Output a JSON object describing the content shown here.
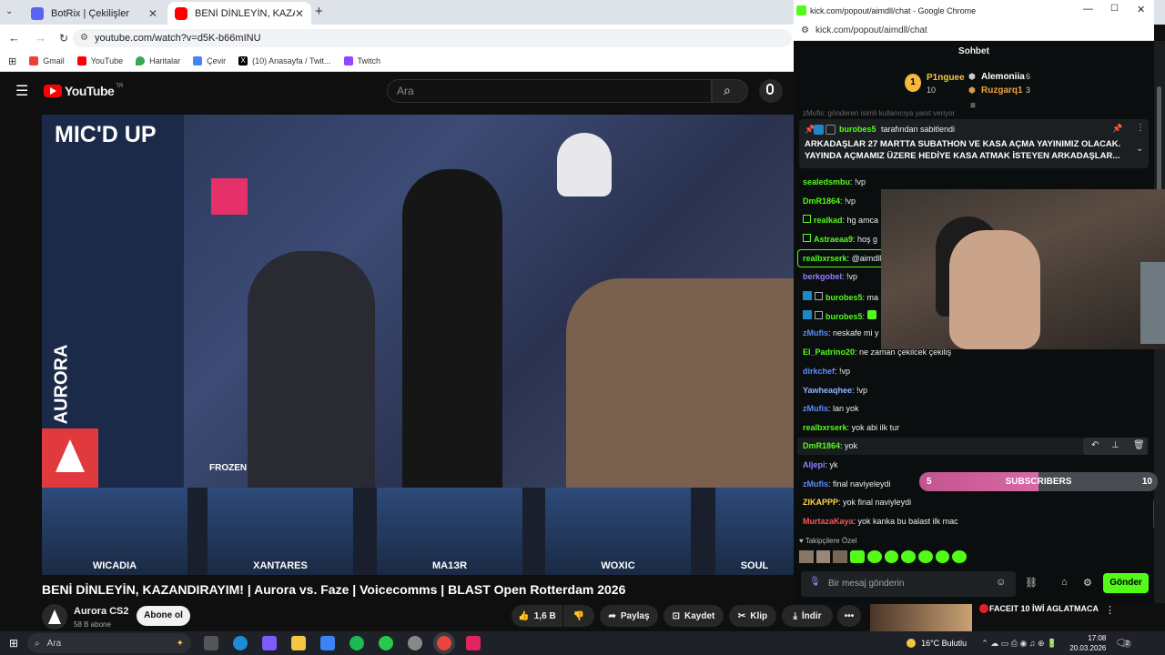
{
  "browser": {
    "tabs": [
      {
        "label": "BotRix | Çekilişler",
        "color": "#5865f2"
      },
      {
        "label": "BENİ DİNLEYİN, KAZANDIRAYIM! ...",
        "color": "#ff0000"
      }
    ],
    "new_tab": "+",
    "url": "youtube.com/watch?v=d5K-b66mINU",
    "bookmarks": [
      {
        "label": "Gmail",
        "color": "#ea4335"
      },
      {
        "label": "YouTube",
        "color": "#ff0000"
      },
      {
        "label": "Haritalar",
        "color": "#34a853"
      },
      {
        "label": "Çevir",
        "color": "#4285f4"
      },
      {
        "label": "(10) Anasayfa / Twit...",
        "color": "#000000"
      },
      {
        "label": "Twitch",
        "color": "#9146ff"
      }
    ]
  },
  "youtube": {
    "logo": "YouTube",
    "region": "TR",
    "search_placeholder": "Ara",
    "video_title": "BENİ DİNLEYİN, KAZANDIRAYIM! | Aurora vs. Faze | Voicecomms | BLAST Open Rotterdam 2026",
    "overlay_title": "MIC'D UP",
    "overlay_team": "AURORA",
    "overlay_frozen": "FROZEN",
    "players": [
      "WICADIA",
      "XANTARES",
      "MA1ЗR",
      "WOXIC",
      "SOUL"
    ],
    "channel_name": "Aurora CS2",
    "subscribers": "58 B abone",
    "subscribe": "Abone ol",
    "likes": "1,6 B",
    "share": "Paylaş",
    "save": "Kaydet",
    "clip": "Klip",
    "download": "İndir",
    "more": "•••",
    "next_title": "FACEIT 10 İWİ AGLATMACA"
  },
  "popup": {
    "title": "kick.com/popout/aimdll/chat - Google Chrome",
    "url": "kick.com/popout/aimdll/chat",
    "header": "Sohbet",
    "leaders": [
      {
        "rank": "1",
        "name": "P1nguee",
        "count": "10"
      },
      {
        "rank": "",
        "name": "Alemoniia",
        "count": "6"
      },
      {
        "rank": "",
        "name": "Ruzgarq1",
        "count": "3"
      }
    ],
    "pinned_by": "burobes5",
    "pinned_by_suffix": "tarafından sabitlendi",
    "pinned_text_1": "ARKADAŞLAR 27 MARTTA SUBATHON VE KASA AÇMA YAYINIMIZ OLACAK.",
    "pinned_text_2": "YAYINDA AÇMAMIZ ÜZERE HEDİYE KASA ATMAK İSTEYEN ARKADAŞLAR...",
    "faded_line": "zMufis: gönderen isimli kullanıcıya yanıt veriyor",
    "messages": [
      {
        "user": "sealedsmbu",
        "text": "!vp",
        "color": "#53fc18"
      },
      {
        "user": "DmR1864",
        "text": "!vp",
        "color": "#53fc18"
      },
      {
        "user": "realkad",
        "text": "hg amca",
        "color": "#53fc18"
      },
      {
        "user": "Astraeaa9",
        "text": "hoş g",
        "color": "#53fc18"
      },
      {
        "user": "realbxrserk",
        "text": "@aimdll",
        "color": "#53fc18"
      },
      {
        "user": "berkgobel",
        "text": "!vp",
        "color": "#9b7bff"
      },
      {
        "user": "burobes5",
        "text": "ma",
        "color": "#53fc18"
      },
      {
        "user": "burobes5",
        "text": "",
        "color": "#53fc18"
      },
      {
        "user": "zMufis",
        "text": "neskafe mi y",
        "color": "#5b8cff"
      },
      {
        "user": "El_Padrino20",
        "text": "ne zaman çekilcek çekiliş",
        "color": "#53fc18"
      },
      {
        "user": "dirkchef",
        "text": "!vp",
        "color": "#5b8cff"
      },
      {
        "user": "Yawheaqhee",
        "text": "!vp",
        "color": "#8fb3ff"
      },
      {
        "user": "zMufis",
        "text": "lan yok",
        "color": "#5b8cff"
      },
      {
        "user": "realbxrserk",
        "text": "yok abi ilk tur",
        "color": "#53fc18"
      },
      {
        "user": "DmR1864",
        "text": "yok",
        "color": "#53fc18"
      },
      {
        "user": "Aljepi",
        "text": "yk",
        "color": "#9b7bff"
      },
      {
        "user": "zMufis",
        "text": "final naviyeleydi",
        "color": "#5b8cff"
      },
      {
        "user": "ZIKAPPP",
        "text": "yok final naviyleydi",
        "color": "#ffd84a"
      },
      {
        "user": "MurtazaKaya",
        "text": "yok kanka bu balast ilk mac",
        "color": "#ff5252"
      }
    ],
    "subs_label": "SUBSCRIBERS",
    "subs_start": "5",
    "subs_end": "10",
    "subs_progress": 0.5,
    "followers_only": "Takipçilere Özel",
    "input_placeholder": "Bir mesaj gönderin",
    "send": "Gönder"
  },
  "taskbar": {
    "search": "Ara",
    "weather": "16°C  Bulutlu",
    "time": "17:08",
    "date": "20.03.2026",
    "notifications": "2"
  }
}
